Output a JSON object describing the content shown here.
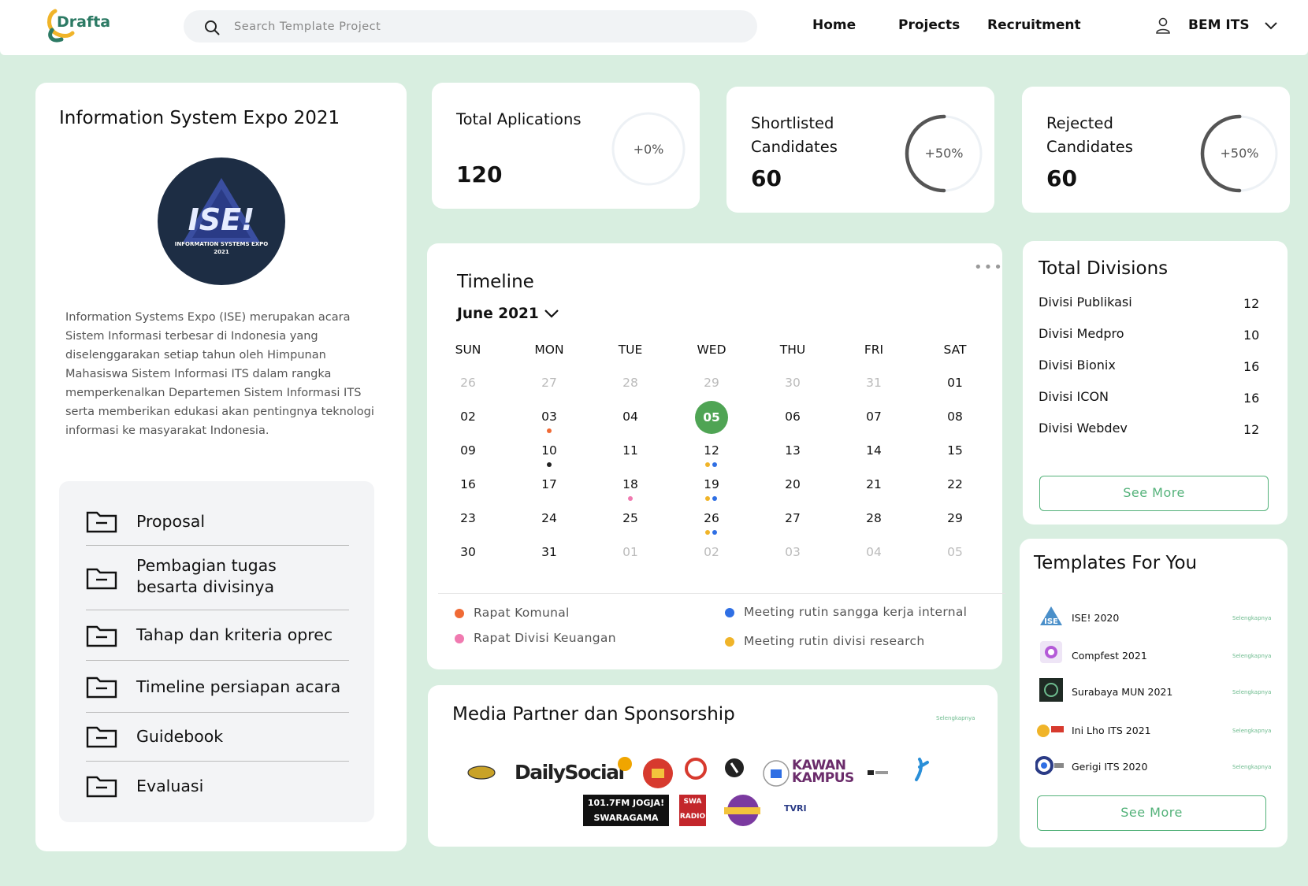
{
  "header": {
    "logo_text": "Drafta",
    "search_placeholder": "Search Template Project",
    "nav": [
      "Home",
      "Projects",
      "Recruitment"
    ],
    "user_name": "BEM ITS"
  },
  "project": {
    "title": "Information System Expo 2021",
    "logo_text": "ISE!",
    "logo_caption": "INFORMATION SYSTEMS EXPO 2021",
    "description": "Information Systems Expo (ISE) merupakan acara Sistem Informasi terbesar di Indonesia yang diselenggarakan setiap tahun oleh Himpunan Mahasiswa Sistem Informasi ITS dalam rangka memperkenalkan Departemen Sistem Informasi ITS serta memberikan edukasi akan pentingnya teknologi informasi ke masyarakat Indonesia.",
    "folders": [
      {
        "label": "Proposal"
      },
      {
        "label": "Pembagian tugas besarta divisinya"
      },
      {
        "label": "Tahap dan kriteria oprec"
      },
      {
        "label": "Timeline persiapan acara"
      },
      {
        "label": "Guidebook"
      },
      {
        "label": "Evaluasi"
      }
    ]
  },
  "stats": [
    {
      "label": "Total Aplications",
      "value": "120",
      "change": "+0%",
      "progress": 0
    },
    {
      "label": "Shortlisted Candidates",
      "value": "60",
      "change": "+50%",
      "progress": 0.5
    },
    {
      "label": "Rejected Candidates",
      "value": "60",
      "change": "+50%",
      "progress": 0.5
    }
  ],
  "timeline": {
    "title": "Timeline",
    "month": "June 2021",
    "more": "•••",
    "weekdays": [
      "SUN",
      "MON",
      "TUE",
      "WED",
      "THU",
      "FRI",
      "SAT"
    ],
    "weeks": [
      [
        {
          "d": "26",
          "m": 1
        },
        {
          "d": "27",
          "m": 1
        },
        {
          "d": "28",
          "m": 1
        },
        {
          "d": "29",
          "m": 1
        },
        {
          "d": "30",
          "m": 1
        },
        {
          "d": "31",
          "m": 1
        },
        {
          "d": "01"
        }
      ],
      [
        {
          "d": "02"
        },
        {
          "d": "03",
          "dots": [
            "#f06a35"
          ]
        },
        {
          "d": "04"
        },
        {
          "d": "05",
          "today": 1
        },
        {
          "d": "06"
        },
        {
          "d": "07"
        },
        {
          "d": "08"
        }
      ],
      [
        {
          "d": "09"
        },
        {
          "d": "10",
          "dots": [
            "#222"
          ]
        },
        {
          "d": "11"
        },
        {
          "d": "12",
          "dots": [
            "#f0b429",
            "#2f6fe4"
          ]
        },
        {
          "d": "13"
        },
        {
          "d": "14"
        },
        {
          "d": "15"
        }
      ],
      [
        {
          "d": "16"
        },
        {
          "d": "17"
        },
        {
          "d": "18",
          "dots": [
            "#f07ab0"
          ]
        },
        {
          "d": "19",
          "dots": [
            "#f0b429",
            "#2f6fe4"
          ]
        },
        {
          "d": "20"
        },
        {
          "d": "21"
        },
        {
          "d": "22"
        }
      ],
      [
        {
          "d": "23"
        },
        {
          "d": "24"
        },
        {
          "d": "25"
        },
        {
          "d": "26",
          "dots": [
            "#f0b429",
            "#2f6fe4"
          ]
        },
        {
          "d": "27"
        },
        {
          "d": "28"
        },
        {
          "d": "29"
        }
      ],
      [
        {
          "d": "30"
        },
        {
          "d": "31"
        },
        {
          "d": "01",
          "m": 1
        },
        {
          "d": "02",
          "m": 1
        },
        {
          "d": "03",
          "m": 1
        },
        {
          "d": "04",
          "m": 1
        },
        {
          "d": "05",
          "m": 1
        }
      ]
    ],
    "legend": [
      {
        "label": "Rapat Komunal",
        "color": "#f06a35"
      },
      {
        "label": "Rapat Divisi Keuangan",
        "color": "#f07ab0"
      },
      {
        "label": "Meeting rutin sangga kerja internal",
        "color": "#2f6fe4"
      },
      {
        "label": "Meeting rutin divisi research",
        "color": "#f0b429"
      }
    ]
  },
  "media": {
    "title": "Media Partner dan Sponsorship",
    "more": "Selengkapnya",
    "logos": [
      "DailySocial",
      "KAWAN KAMPUS",
      "101.7FM JOGJA! SWARAGAMA",
      "SWA RADIO",
      "TVRI"
    ]
  },
  "divisions": {
    "title": "Total Divisions",
    "items": [
      {
        "name": "Divisi Publikasi",
        "count": "12"
      },
      {
        "name": "Divisi Medpro",
        "count": "10"
      },
      {
        "name": "Divisi Bionix",
        "count": "16"
      },
      {
        "name": "Divisi ICON",
        "count": "16"
      },
      {
        "name": "Divisi Webdev",
        "count": "12"
      }
    ],
    "see_more": "See More"
  },
  "templates": {
    "title": "Templates For You",
    "items": [
      {
        "name": "ISE! 2020",
        "more": "Selengkapnya"
      },
      {
        "name": "Compfest 2021",
        "more": "Selengkapnya"
      },
      {
        "name": "Surabaya MUN 2021",
        "more": "Selengkapnya"
      },
      {
        "name": "Ini Lho ITS 2021",
        "more": "Selengkapnya"
      },
      {
        "name": "Gerigi ITS 2020",
        "more": "Selengkapnya"
      }
    ],
    "see_more": "See More"
  },
  "colors": {
    "background": "#d8eee0",
    "accent": "#54b27a",
    "today": "#4fa454",
    "ring": "#555555"
  }
}
